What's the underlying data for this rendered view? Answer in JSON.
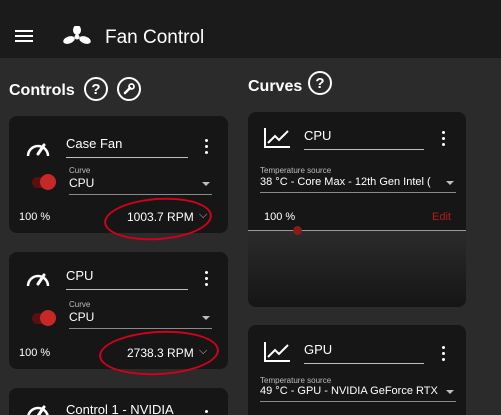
{
  "app": {
    "title": "Fan Control"
  },
  "controls": {
    "title": "Controls",
    "cards": [
      {
        "name": "Case Fan",
        "curve_label": "Curve",
        "curve_value": "CPU",
        "percent": "100 %",
        "rpm": "1003.7 RPM"
      },
      {
        "name": "CPU",
        "curve_label": "Curve",
        "curve_value": "CPU",
        "percent": "100 %",
        "rpm": "2738.3 RPM"
      },
      {
        "name": "Control 1 - NVIDIA"
      }
    ]
  },
  "curves": {
    "title": "Curves",
    "cards": [
      {
        "name": "CPU",
        "source_label": "Temperature source",
        "source_value": "38 °C - Core Max - 12th Gen Intel (",
        "percent": "100 %",
        "edit_label": "Edit"
      },
      {
        "name": "GPU",
        "source_label": "Temperature source",
        "source_value": "49 °C - GPU - NVIDIA GeForce RTX"
      }
    ]
  },
  "colors": {
    "topbar": "#1b1b1b",
    "background": "#2b2b2b",
    "card": "#161616",
    "accent_red": "#c62828",
    "annotation_red": "#d0021b"
  },
  "icons": {
    "menu": "hamburger-icon",
    "logo": "fan-logo-icon",
    "help": "help-icon",
    "wrench": "wrench-icon",
    "gauge": "gauge-icon",
    "kebab": "kebab-menu-icon",
    "curve": "curve-graph-icon"
  }
}
